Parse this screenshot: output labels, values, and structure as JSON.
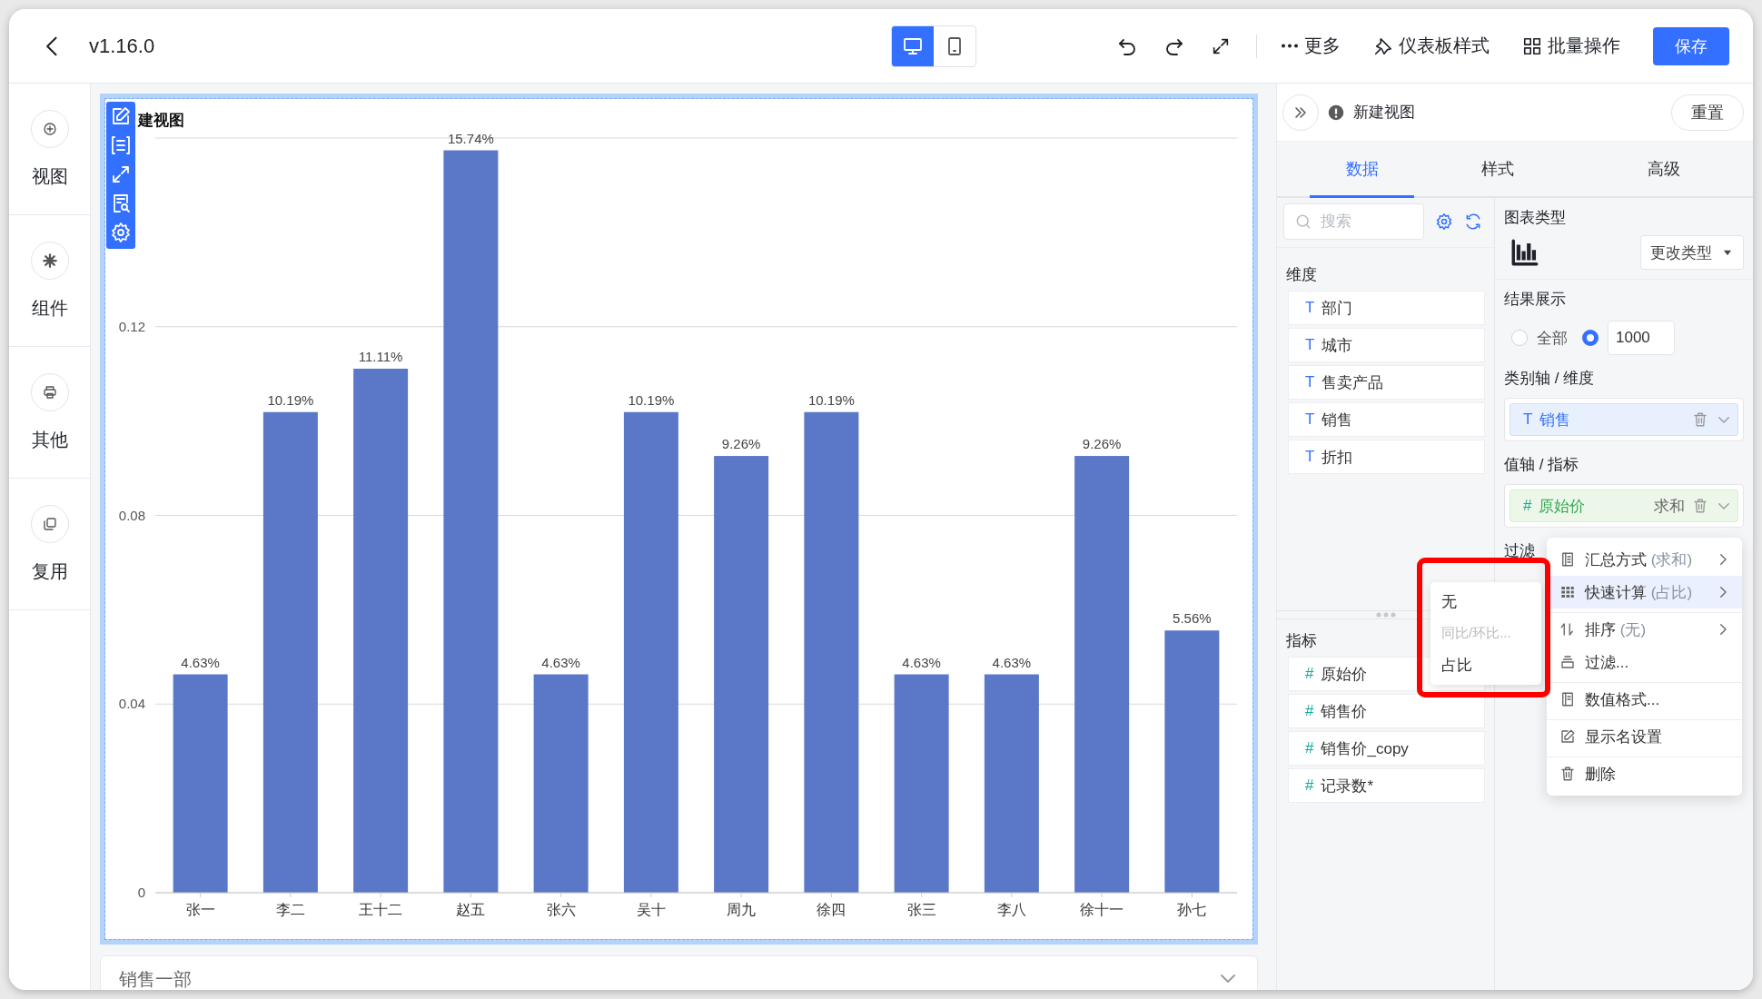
{
  "topbar": {
    "title": "v1.16.0",
    "view_modes": [
      {
        "kind": "desktop",
        "selected": true
      },
      {
        "kind": "mobile",
        "selected": false
      }
    ],
    "more": "更多",
    "actions": [
      {
        "kind": "style",
        "label": "仪表板样式"
      },
      {
        "kind": "batch",
        "label": "批量操作"
      }
    ],
    "save": "保存"
  },
  "sidebar": {
    "items": [
      {
        "kind": "view",
        "label": "视图"
      },
      {
        "kind": "component",
        "label": "组件"
      },
      {
        "kind": "other",
        "label": "其他"
      },
      {
        "kind": "reuse",
        "label": "复用"
      }
    ]
  },
  "chart": {
    "title": "建视图",
    "chart_data": {
      "type": "bar",
      "categories": [
        "张一",
        "李二",
        "王十二",
        "赵五",
        "张六",
        "吴十",
        "周九",
        "徐四",
        "张三",
        "李八",
        "徐十一",
        "孙七"
      ],
      "series": [
        {
          "color": "#5b77c7",
          "values": [
            0.0463,
            0.1019,
            0.1111,
            0.1574,
            0.0463,
            0.1019,
            0.0926,
            0.1019,
            0.0463,
            0.0463,
            0.0926,
            0.0556
          ]
        }
      ],
      "value_labels": [
        "4.63%",
        "10.19%",
        "11.11%",
        "15.74%",
        "4.63%",
        "10.19%",
        "9.26%",
        "10.19%",
        "4.63%",
        "4.63%",
        "9.26%",
        "5.56%"
      ],
      "grid": true,
      "ylim": [
        0,
        0.16
      ],
      "yticks": [
        0,
        0.04,
        0.08,
        0.12
      ]
    }
  },
  "next_card": {
    "title": "销售一部"
  },
  "panel": {
    "title": "新建视图",
    "reset": "重置",
    "tabs": [
      {
        "label": "数据",
        "selected": true
      },
      {
        "label": "样式",
        "selected": false
      },
      {
        "label": "高级",
        "selected": false
      }
    ],
    "search": {
      "placeholder": "搜索"
    },
    "dimensions": {
      "heading": "维度",
      "items": [
        {
          "symbol": "T",
          "name": "部门"
        },
        {
          "symbol": "T",
          "name": "城市"
        },
        {
          "symbol": "T",
          "name": "售卖产品"
        },
        {
          "symbol": "T",
          "name": "销售"
        },
        {
          "symbol": "T",
          "name": "折扣"
        }
      ]
    },
    "measures": {
      "heading": "指标",
      "items": [
        {
          "symbol": "#",
          "name": "原始价"
        },
        {
          "symbol": "#",
          "name": "销售价"
        },
        {
          "symbol": "#",
          "name": "销售价_copy"
        },
        {
          "symbol": "#",
          "name": "记录数*"
        }
      ]
    },
    "chart_type": {
      "heading": "图表类型",
      "change": "更改类型"
    },
    "result": {
      "heading": "结果展示",
      "all": {
        "label": "全部",
        "selected": false
      },
      "limit": {
        "value": "1000",
        "selected": true
      }
    },
    "category_axis": {
      "heading": "类别轴 / 维度",
      "field": {
        "symbol": "T",
        "name": "销售"
      }
    },
    "value_axis": {
      "heading": "值轴 / 指标",
      "field": {
        "symbol": "#",
        "name": "原始价",
        "aggregate": "求和"
      }
    },
    "filter": {
      "heading": "过滤"
    }
  },
  "context_menu": {
    "items": [
      {
        "kind": "summary",
        "label": "汇总方式",
        "detail": "(求和)",
        "submenu": true,
        "selected": false,
        "divider_before": false
      },
      {
        "kind": "quick_calc",
        "label": "快速计算",
        "detail": "(占比)",
        "submenu": true,
        "selected": true,
        "divider_before": false
      },
      {
        "kind": "sort",
        "label": "排序",
        "detail": "(无)",
        "submenu": true,
        "selected": false,
        "divider_before": true
      },
      {
        "kind": "filter",
        "label": "过滤...",
        "submenu": false,
        "selected": false,
        "divider_before": false
      },
      {
        "kind": "format",
        "label": "数值格式...",
        "submenu": false,
        "selected": false,
        "divider_before": true
      },
      {
        "kind": "rename",
        "label": "显示名设置",
        "submenu": false,
        "selected": false,
        "divider_before": true
      },
      {
        "kind": "delete",
        "label": "删除",
        "submenu": false,
        "selected": false,
        "divider_before": true
      }
    ]
  },
  "submenu": {
    "highlighted": true,
    "items": [
      {
        "label": "无",
        "disabled": false
      },
      {
        "label": "同比/环比...",
        "disabled": true
      },
      {
        "label": "占比",
        "disabled": false
      }
    ]
  }
}
